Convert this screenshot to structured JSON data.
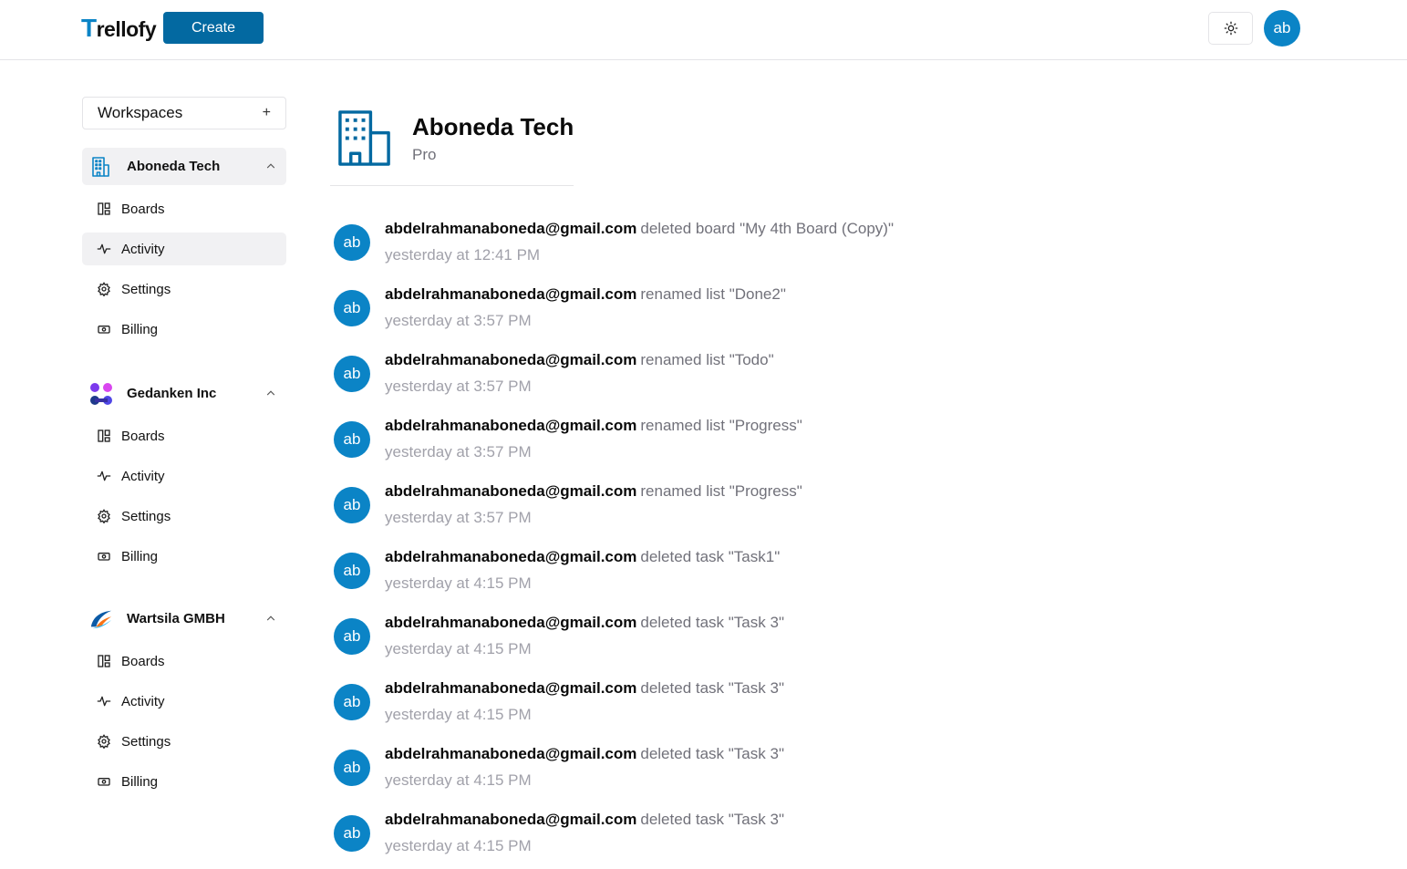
{
  "header": {
    "logo_first": "T",
    "logo_rest": "rellofy",
    "create_label": "Create",
    "avatar_initials": "ab",
    "theme_icon": "sun-icon"
  },
  "sidebar": {
    "title": "Workspaces",
    "add_symbol": "+",
    "workspaces": [
      {
        "name": "Aboneda Tech",
        "icon": "building-icon",
        "expanded": true,
        "items": [
          {
            "label": "Boards",
            "icon": "board-icon"
          },
          {
            "label": "Activity",
            "icon": "activity-icon"
          },
          {
            "label": "Settings",
            "icon": "settings-icon"
          },
          {
            "label": "Billing",
            "icon": "billing-icon"
          }
        ]
      },
      {
        "name": "Gedanken Inc",
        "icon": "molecule-logo-icon",
        "expanded": true,
        "items": [
          {
            "label": "Boards",
            "icon": "board-icon"
          },
          {
            "label": "Activity",
            "icon": "activity-icon"
          },
          {
            "label": "Settings",
            "icon": "settings-icon"
          },
          {
            "label": "Billing",
            "icon": "billing-icon"
          }
        ]
      },
      {
        "name": "Wartsila GMBH",
        "icon": "swoosh-logo-icon",
        "expanded": true,
        "items": [
          {
            "label": "Boards",
            "icon": "board-icon"
          },
          {
            "label": "Activity",
            "icon": "activity-icon"
          },
          {
            "label": "Settings",
            "icon": "settings-icon"
          },
          {
            "label": "Billing",
            "icon": "billing-icon"
          }
        ]
      }
    ]
  },
  "org": {
    "name": "Aboneda Tech",
    "plan": "Pro",
    "icon": "building-icon"
  },
  "activity": [
    {
      "avatar": "ab",
      "email": "abdelrahmanaboneda@gmail.com",
      "action": "deleted board \"My 4th Board (Copy)\"",
      "time": "yesterday at 12:41 PM"
    },
    {
      "avatar": "ab",
      "email": "abdelrahmanaboneda@gmail.com",
      "action": "renamed list \"Done2\"",
      "time": "yesterday at 3:57 PM"
    },
    {
      "avatar": "ab",
      "email": "abdelrahmanaboneda@gmail.com",
      "action": "renamed list \"Todo\"",
      "time": "yesterday at 3:57 PM"
    },
    {
      "avatar": "ab",
      "email": "abdelrahmanaboneda@gmail.com",
      "action": "renamed list \"Progress\"",
      "time": "yesterday at 3:57 PM"
    },
    {
      "avatar": "ab",
      "email": "abdelrahmanaboneda@gmail.com",
      "action": "renamed list \"Progress\"",
      "time": "yesterday at 3:57 PM"
    },
    {
      "avatar": "ab",
      "email": "abdelrahmanaboneda@gmail.com",
      "action": "deleted task \"Task1\"",
      "time": "yesterday at 4:15 PM"
    },
    {
      "avatar": "ab",
      "email": "abdelrahmanaboneda@gmail.com",
      "action": "deleted task \"Task 3\"",
      "time": "yesterday at 4:15 PM"
    },
    {
      "avatar": "ab",
      "email": "abdelrahmanaboneda@gmail.com",
      "action": "deleted task \"Task 3\"",
      "time": "yesterday at 4:15 PM"
    },
    {
      "avatar": "ab",
      "email": "abdelrahmanaboneda@gmail.com",
      "action": "deleted task \"Task 3\"",
      "time": "yesterday at 4:15 PM"
    },
    {
      "avatar": "ab",
      "email": "abdelrahmanaboneda@gmail.com",
      "action": "deleted task \"Task 3\"",
      "time": "yesterday at 4:15 PM"
    }
  ],
  "colors": {
    "brand": "#0b84c6",
    "primary_button": "#0369a1",
    "muted_text": "#71717a",
    "active_bg": "#f1f1f3"
  }
}
